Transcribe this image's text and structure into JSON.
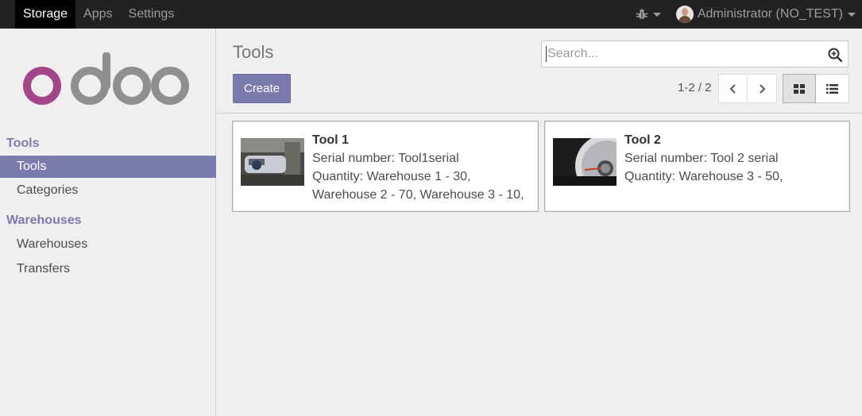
{
  "topbar": {
    "menu": [
      {
        "label": "Storage",
        "active": true
      },
      {
        "label": "Apps",
        "active": false
      },
      {
        "label": "Settings",
        "active": false
      }
    ],
    "user": "Administrator (NO_TEST)"
  },
  "sidebar": {
    "logo": "odoo",
    "sections": [
      {
        "title": "Tools",
        "items": [
          {
            "label": "Tools",
            "active": true
          },
          {
            "label": "Categories",
            "active": false
          }
        ]
      },
      {
        "title": "Warehouses",
        "items": [
          {
            "label": "Warehouses",
            "active": false
          },
          {
            "label": "Transfers",
            "active": false
          }
        ]
      }
    ]
  },
  "control_panel": {
    "title": "Tools",
    "create_label": "Create",
    "search_placeholder": "Search...",
    "pager": "1-2 / 2"
  },
  "cards": [
    {
      "name": "Tool 1",
      "serial": "Serial number: Tool1serial",
      "quantity_line1": "Quantity: Warehouse 1 - 30,",
      "quantity_line2": "Warehouse 2 - 70, Warehouse 3 - 10,"
    },
    {
      "name": "Tool 2",
      "serial": "Serial number: Tool 2 serial",
      "quantity_line1": "Quantity: Warehouse 3 - 50,",
      "quantity_line2": ""
    }
  ],
  "colors": {
    "brand": "#7c7bad",
    "navbar": "#222222",
    "background": "#f0eeee"
  }
}
